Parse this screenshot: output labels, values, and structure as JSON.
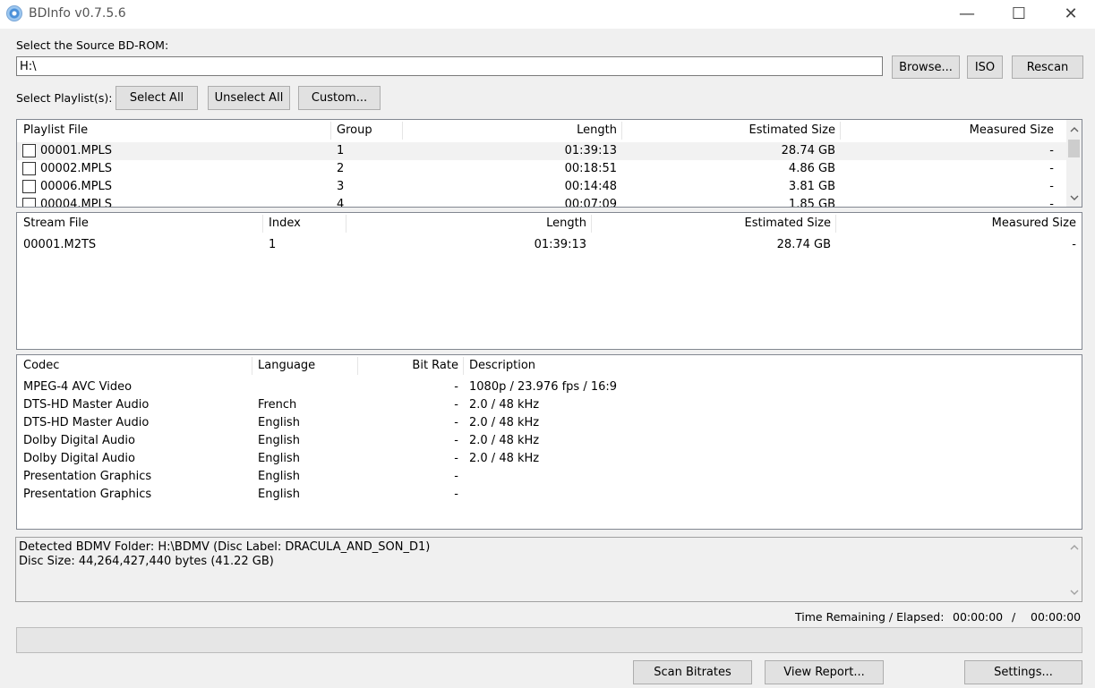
{
  "window": {
    "title": "BDInfo v0.7.5.6",
    "minimize": "—",
    "maximize": "☐",
    "close": "✕"
  },
  "source": {
    "label": "Select the Source BD-ROM:",
    "value": "H:\\",
    "browse": "Browse...",
    "iso": "ISO",
    "rescan": "Rescan"
  },
  "playlists": {
    "label": "Select Playlist(s):",
    "select_all": "Select All",
    "unselect_all": "Unselect All",
    "custom": "Custom...",
    "columns": [
      "Playlist File",
      "Group",
      "Length",
      "Estimated Size",
      "Measured Size"
    ],
    "rows": [
      [
        "00001.MPLS",
        "1",
        "01:39:13",
        "28.74 GB",
        "-"
      ],
      [
        "00002.MPLS",
        "2",
        "00:18:51",
        "4.86 GB",
        "-"
      ],
      [
        "00006.MPLS",
        "3",
        "00:14:48",
        "3.81 GB",
        "-"
      ],
      [
        "00004.MPLS",
        "4",
        "00:07:09",
        "1.85 GB",
        "-"
      ]
    ]
  },
  "streams": {
    "columns": [
      "Stream File",
      "Index",
      "Length",
      "Estimated Size",
      "Measured Size"
    ],
    "rows": [
      [
        "00001.M2TS",
        "1",
        "01:39:13",
        "28.74 GB",
        "-"
      ]
    ]
  },
  "codecs": {
    "columns": [
      "Codec",
      "Language",
      "Bit Rate",
      "Description"
    ],
    "rows": [
      [
        "MPEG-4 AVC Video",
        "",
        "-",
        "1080p / 23.976 fps / 16:9"
      ],
      [
        "DTS-HD Master Audio",
        "French",
        "-",
        "2.0 / 48 kHz"
      ],
      [
        "DTS-HD Master Audio",
        "English",
        "-",
        "2.0 / 48 kHz"
      ],
      [
        "Dolby Digital Audio",
        "English",
        "-",
        "2.0 / 48 kHz"
      ],
      [
        "Dolby Digital Audio",
        "English",
        "-",
        "2.0 / 48 kHz"
      ],
      [
        "Presentation Graphics",
        "English",
        "-",
        ""
      ],
      [
        "Presentation Graphics",
        "English",
        "-",
        ""
      ]
    ]
  },
  "status": {
    "lines": [
      "Detected BDMV Folder: H:\\BDMV (Disc Label: DRACULA_AND_SON_D1)",
      "Disc Size: 44,264,427,440 bytes (41.22 GB)"
    ]
  },
  "timing": {
    "label": "Time Remaining / Elapsed:",
    "remaining": "00:00:00",
    "separator": "/",
    "elapsed": "00:00:00"
  },
  "progress": {
    "value": 0
  },
  "actions": {
    "scan": "Scan Bitrates",
    "report": "View Report...",
    "settings": "Settings..."
  }
}
